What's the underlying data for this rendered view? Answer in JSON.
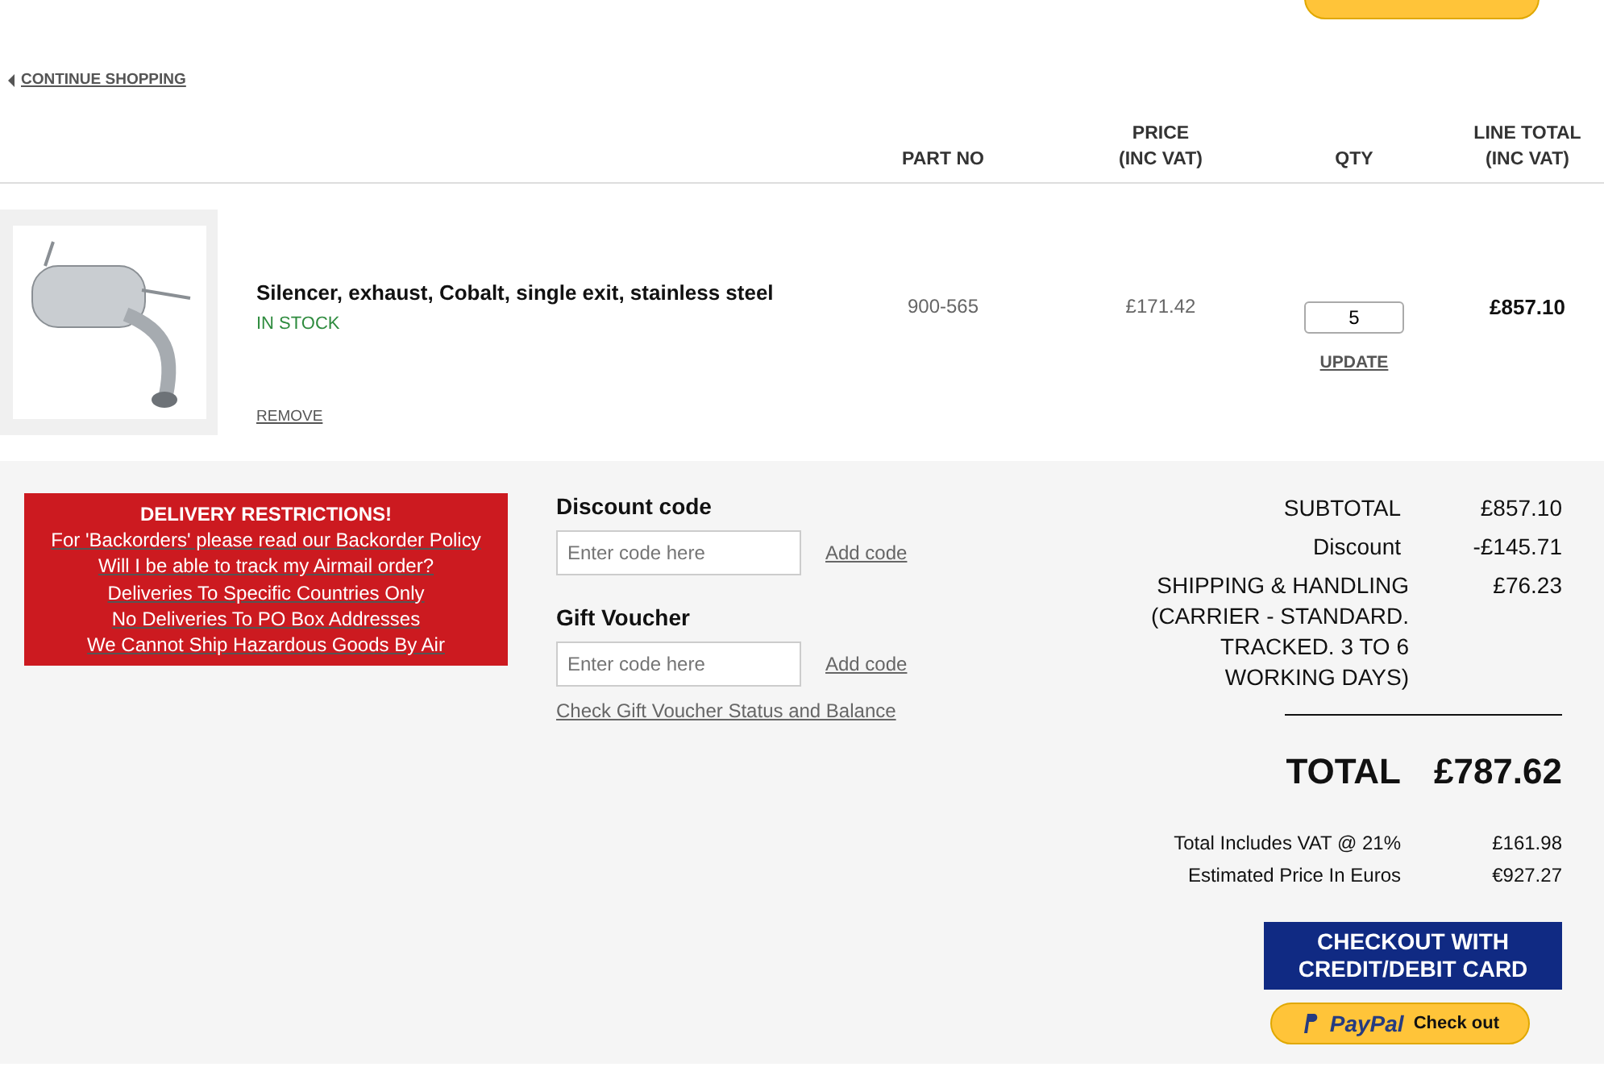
{
  "continue_link": "CONTINUE SHOPPING",
  "table": {
    "columns": [
      {
        "label": "PART NO"
      },
      {
        "label": "PRICE\n(INC VAT)"
      },
      {
        "label": "QTY"
      },
      {
        "label": "LINE TOTAL\n(INC VAT)"
      }
    ],
    "rows": [
      {
        "name": "Silencer, exhaust, Cobalt, single exit, stainless steel",
        "stock": "IN STOCK",
        "part_no": "900-565",
        "price": "£171.42",
        "qty": "5",
        "update": "UPDATE",
        "line_total": "£857.10",
        "remove": "REMOVE"
      }
    ]
  },
  "delivery_restrictions": {
    "title": "DELIVERY RESTRICTIONS!",
    "links": [
      "For 'Backorders' please read our Backorder Policy",
      "Will I be able to track my Airmail order?",
      "Deliveries To Specific Countries Only",
      "No Deliveries To PO Box Addresses",
      "We Cannot Ship Hazardous Goods By Air"
    ]
  },
  "codes": [
    {
      "label": "Discount code",
      "placeholder": "Enter code here",
      "action": "Add code"
    },
    {
      "label": "Gift Voucher",
      "placeholder": "Enter code here",
      "action": "Add code"
    }
  ],
  "voucher_link": "Check Gift Voucher Status and Balance",
  "summary": [
    {
      "label": "SUBTOTAL",
      "value": "£857.10"
    },
    {
      "label": "Discount",
      "value": "-£145.71"
    },
    {
      "label": "SHIPPING & HANDLING (CARRIER - STANDARD. TRACKED. 3 TO 6 WORKING DAYS)",
      "value": "£76.23"
    }
  ],
  "total": {
    "label": "TOTAL",
    "value": "£787.62"
  },
  "extras": [
    {
      "label": "Total Includes VAT @ 21%",
      "value": "£161.98"
    },
    {
      "label": "Estimated Price In Euros",
      "value": "€927.27"
    }
  ],
  "checkout_button": "CHECKOUT WITH CREDIT/DEBIT CARD",
  "paypal": {
    "brand": "PayPal",
    "label": "Check out"
  }
}
